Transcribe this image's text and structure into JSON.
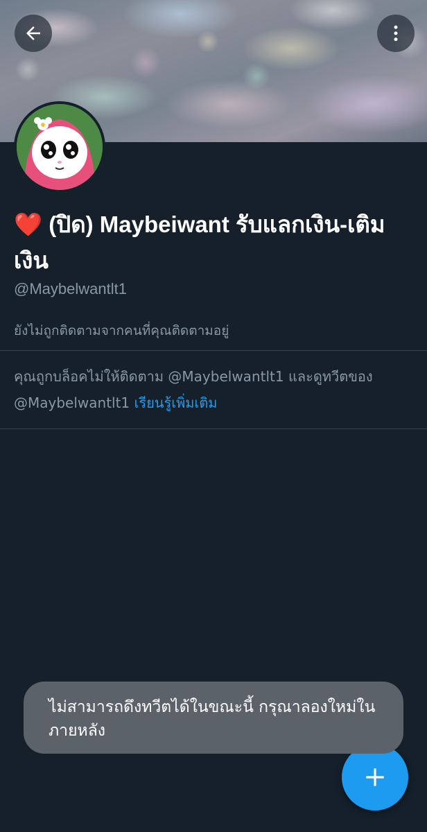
{
  "header": {
    "back_icon": "arrow-left-icon",
    "more_icon": "more-vertical-icon"
  },
  "profile": {
    "display_name": "❤️ (ปิด) Maybeiwant รับแลกเงิน-เติมเงิน",
    "handle": "@Maybelwantlt1",
    "follow_note": "ยังไม่ถูกติดตามจากคนที่คุณติดตามอยู่",
    "blocked_text_1": "คุณถูกบล็อคไม่ให้ติดตาม @Maybelwantlt1 และดูทวีตของ @Maybelwantlt1 ",
    "learn_more": "เรียนรู้เพิ่มเติม"
  },
  "toast": {
    "message": "ไม่สามารถดึงทวีตได้ในขณะนี้ กรุณาลองใหม่ในภายหลัง"
  },
  "fab": {
    "icon": "plus-icon"
  },
  "colors": {
    "background": "#15202b",
    "accent": "#1d9bf0",
    "secondary_text": "#8899a6",
    "divider": "#38444d",
    "toast": "#5b6269"
  }
}
